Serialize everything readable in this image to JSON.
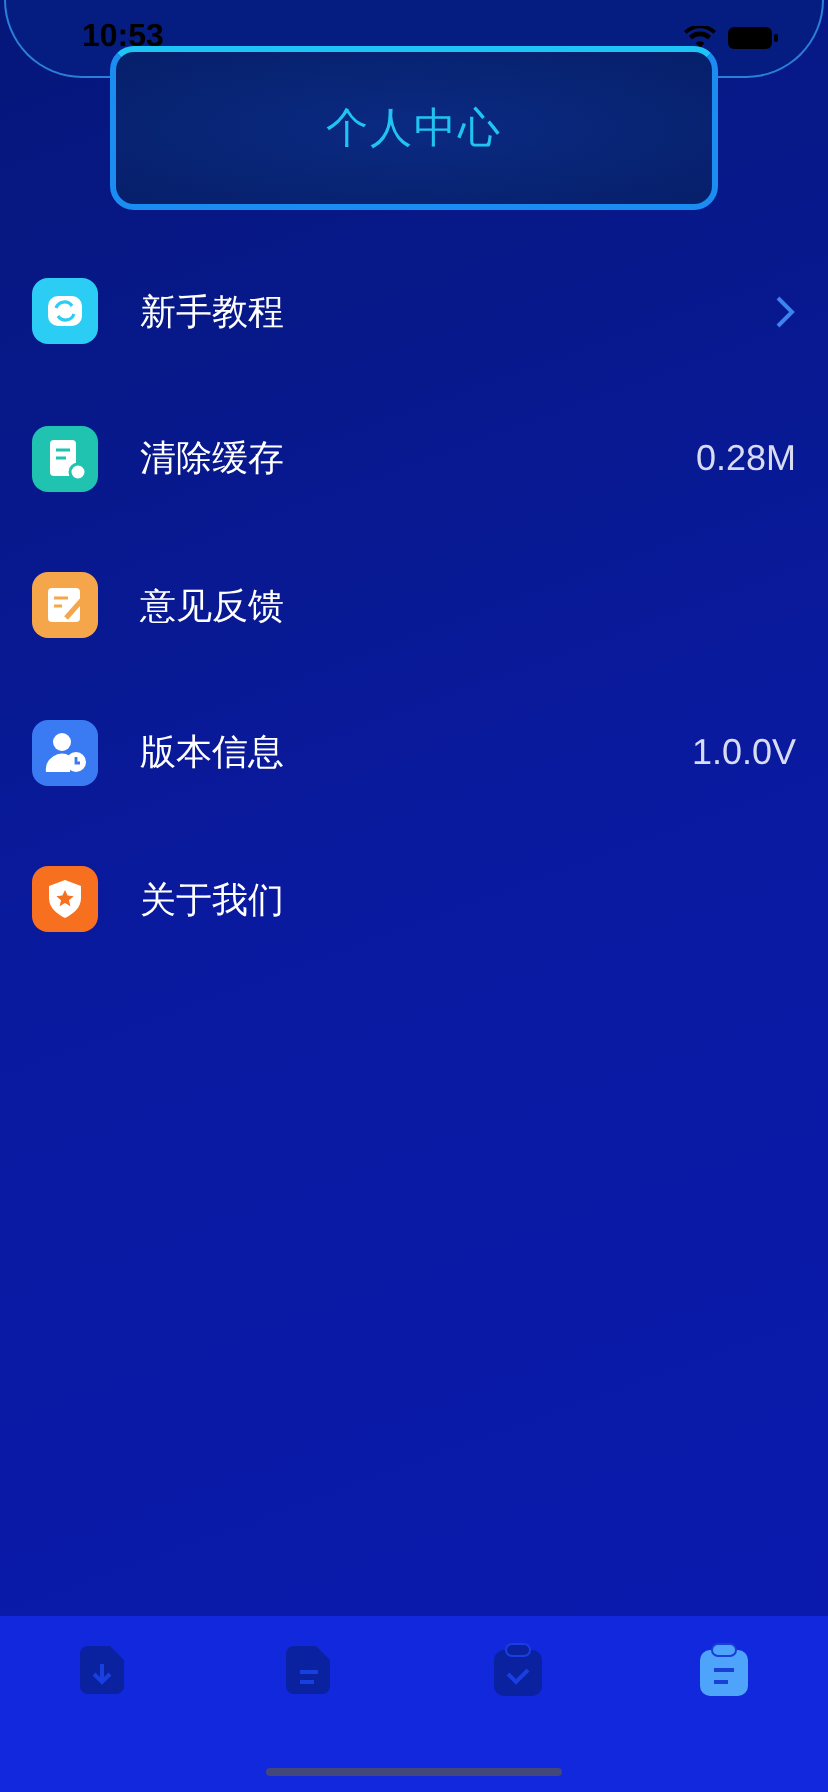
{
  "status_bar": {
    "time": "10:53"
  },
  "header": {
    "title": "个人中心"
  },
  "menu": [
    {
      "label": "新手教程",
      "kind": "chevron"
    },
    {
      "label": "清除缓存",
      "kind": "value",
      "value": "0.28M"
    },
    {
      "label": "意见反馈",
      "kind": "plain"
    },
    {
      "label": "版本信息",
      "kind": "value",
      "value": "1.0.0V"
    },
    {
      "label": "关于我们",
      "kind": "plain"
    }
  ],
  "tab_bar": [
    {
      "selected": false
    },
    {
      "selected": false
    },
    {
      "selected": false
    },
    {
      "selected": true
    }
  ]
}
